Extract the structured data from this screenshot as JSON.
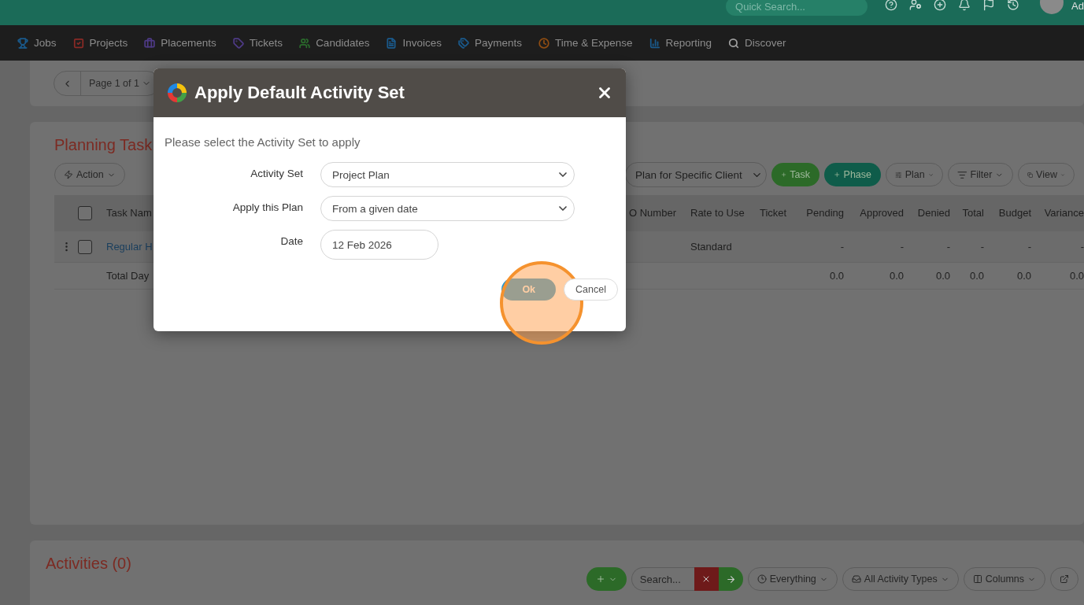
{
  "top_bar": {
    "search": {
      "placeholder": "Quick Search..."
    },
    "user_name": "Ad"
  },
  "nav": [
    {
      "label": "Jobs",
      "color": "#1a5a8c"
    },
    {
      "label": "Projects",
      "color": "#8a2a26"
    },
    {
      "label": "Placements",
      "color": "#4e3a86"
    },
    {
      "label": "Tickets",
      "color": "#4e3a86"
    },
    {
      "label": "Candidates",
      "color": "#2a6a2c"
    },
    {
      "label": "Invoices",
      "color": "#1a5a8c"
    },
    {
      "label": "Payments",
      "color": "#1a5a8c"
    },
    {
      "label": "Time & Expense",
      "color": "#8e4c12"
    },
    {
      "label": "Reporting",
      "color": "#1a5a8c"
    },
    {
      "label": "Discover",
      "color": "#a0a0a0"
    }
  ],
  "pager": {
    "label": "Page 1 of 1"
  },
  "planning": {
    "title": "Planning Task",
    "action": "Action",
    "client_select": "Plan for Specific Client",
    "add_buttons": [
      {
        "label": "Task",
        "kind": "green"
      },
      {
        "label": "Phase",
        "kind": "teal"
      }
    ],
    "menus": [
      "Plan",
      "Filter",
      "View"
    ],
    "header": {
      "checked": false,
      "task": "Task Nam",
      "columns": [
        "O Number",
        "Rate to Use",
        "Ticket",
        "Pending",
        "Approved",
        "Denied",
        "Total",
        "Budget",
        "Variance"
      ]
    },
    "rows": [
      {
        "checked": false,
        "task": "Regular H",
        "cells": [
          "",
          "Standard",
          "",
          "-",
          "-",
          "-",
          "-",
          "-",
          "-"
        ]
      }
    ],
    "total": {
      "label": "Total Day",
      "cells": [
        "",
        "",
        "",
        "0.0",
        "0.0",
        "0.0",
        "0.0",
        "0.0",
        "0.0"
      ]
    }
  },
  "activities": {
    "title": "Activities (0)",
    "search": {
      "placeholder": "Search..."
    },
    "menus": [
      "Everything",
      "All Activity Types",
      "Columns"
    ]
  },
  "dialog": {
    "title": "Apply Default Activity Set",
    "prompt": "Please select the Activity Set to apply",
    "fields": [
      {
        "label": "Activity Set",
        "kind": "select",
        "value": "Project Plan"
      },
      {
        "label": "Apply this Plan",
        "kind": "select",
        "value": "From a given date"
      },
      {
        "label": "Date",
        "kind": "date",
        "value": "12 Feb 2026"
      }
    ],
    "buttons": [
      {
        "label": "Ok",
        "kind": "primary"
      },
      {
        "label": "Cancel",
        "kind": "secondary"
      }
    ]
  }
}
